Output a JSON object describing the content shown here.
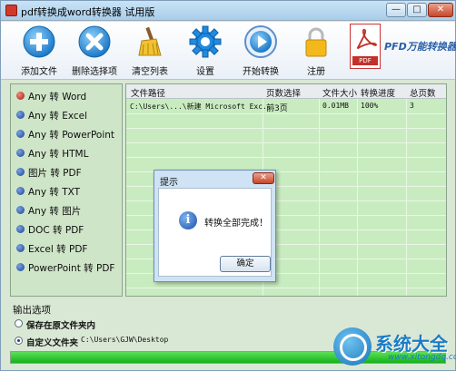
{
  "window": {
    "title": "pdf转换成word转换器 试用版",
    "min_label": "—",
    "max_label": "□",
    "close_label": "✕"
  },
  "toolbar": {
    "items": [
      {
        "label": "添加文件",
        "icon": "plus-icon"
      },
      {
        "label": "删除选择项",
        "icon": "delete-icon"
      },
      {
        "label": "清空列表",
        "icon": "broom-icon"
      },
      {
        "label": "设置",
        "icon": "gear-icon"
      },
      {
        "label": "开始转换",
        "icon": "play-icon"
      },
      {
        "label": "注册",
        "icon": "lock-icon"
      }
    ],
    "brand_text": "PFD万能转换器",
    "brand_doc_label": "PDF"
  },
  "formats": [
    {
      "label": "Any 转 Word",
      "selected": true
    },
    {
      "label": "Any 转 Excel",
      "selected": false
    },
    {
      "label": "Any 转 PowerPoint",
      "selected": false
    },
    {
      "label": "Any 转 HTML",
      "selected": false
    },
    {
      "label": "图片 转 PDF",
      "selected": false
    },
    {
      "label": "Any 转 TXT",
      "selected": false
    },
    {
      "label": "Any 转 图片",
      "selected": false
    },
    {
      "label": "DOC 转 PDF",
      "selected": false
    },
    {
      "label": "Excel 转 PDF",
      "selected": false
    },
    {
      "label": "PowerPoint 转 PDF",
      "selected": false
    }
  ],
  "table": {
    "headers": [
      "文件路径",
      "页数选择",
      "文件大小",
      "转换进度",
      "总页数"
    ],
    "rows": [
      {
        "path": "C:\\Users\\...\\新建 Microsoft Exc...",
        "pages_sel": "前3页",
        "size": "0.01MB",
        "progress": "100%",
        "total": "3"
      }
    ]
  },
  "output": {
    "title": "输出选项",
    "option1": "保存在原文件夹内",
    "option2": "自定义文件夹",
    "path": "C:\\Users\\GJW\\Desktop",
    "progress_fraction": 1.0
  },
  "dialog": {
    "title": "提示",
    "message": "转换全部完成！",
    "ok_label": "确定",
    "close_label": "✕",
    "icon": "info-icon",
    "icon_glyph": "i"
  },
  "watermark": {
    "main": "系统大全",
    "sub": "www.xitongdq.com"
  },
  "colors": {
    "accent_blue": "#1c6fc4",
    "progress_green": "#13b21a",
    "panel_green": "#c8ecc0"
  }
}
